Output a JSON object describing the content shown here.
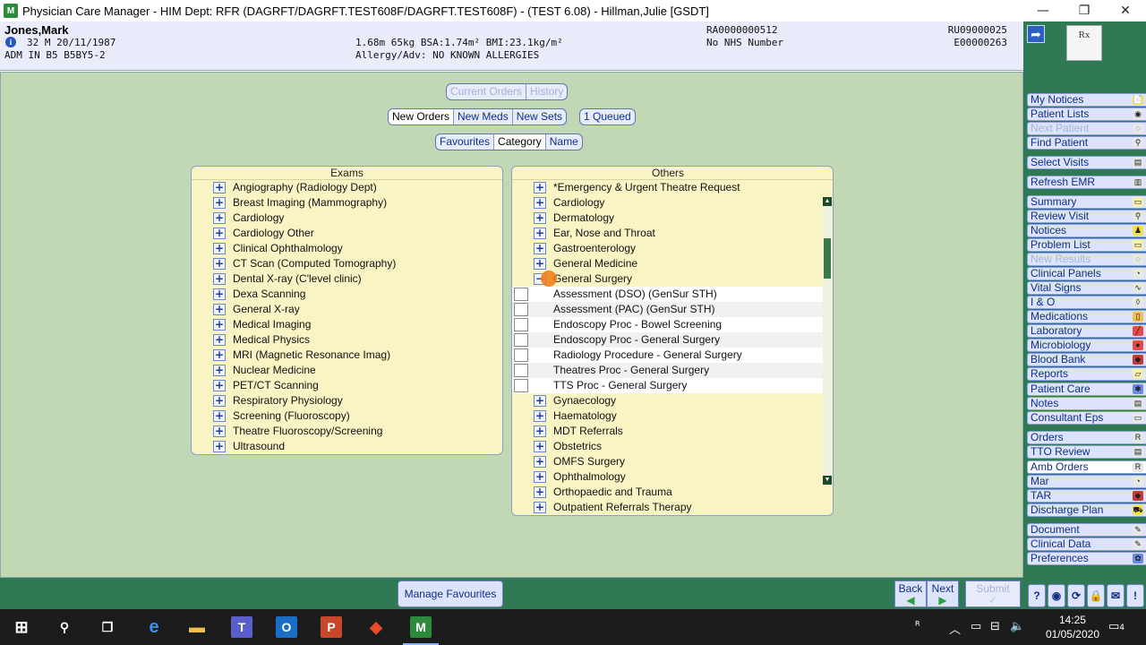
{
  "window": {
    "title": "Physician Care Manager - HIM Dept: RFR (DAGRFT/DAGRFT.TEST608F/DAGRFT.TEST608F) - (TEST 6.08) - Hillman,Julie [GSDT]",
    "app_icon": "M",
    "minimize_glyph": "—",
    "restore_glyph": "❐",
    "close_glyph": "✕"
  },
  "patient": {
    "name": "Jones,Mark",
    "info_glyph": "i",
    "demographics": "32  M  20/11/1987",
    "admission": "ADM IN  B5  B5BY5-2",
    "measurements": "1.68m  65kg  BSA:1.74m²  BMI:23.1kg/m²",
    "allergy": "Allergy/Adv: NO KNOWN ALLERGIES",
    "ra_number": "RA0000000512",
    "nhs": "No NHS Number",
    "ru_number": "RU09000025",
    "e_number": "E00000263"
  },
  "side_header": {
    "arrow_glyph": "➦",
    "rx_glyph": "Rx"
  },
  "sidebar": [
    {
      "label": "My Notices",
      "icon": "📄",
      "icon_color": "#f2e24a"
    },
    {
      "label": "Patient Lists",
      "icon": "◉",
      "icon_color": "#e8e8e8"
    },
    {
      "label": "Next Patient",
      "icon": "◌",
      "icon_color": "#e8e8e8",
      "disabled": true
    },
    {
      "label": "Find Patient",
      "icon": "⚲",
      "icon_color": "#e8e8e8"
    },
    {
      "label": "Select Visits",
      "icon": "▤",
      "icon_color": "#e8e8e8"
    },
    {
      "label": "Refresh EMR",
      "icon": "▥",
      "icon_color": "#e8e8e8"
    },
    {
      "label": "Summary",
      "icon": "▭",
      "icon_color": "#f6efb2"
    },
    {
      "label": "Review Visit",
      "icon": "⚲",
      "icon_color": "#e8e8e8"
    },
    {
      "label": "Notices",
      "icon": "♟",
      "icon_color": "#f2e24a"
    },
    {
      "label": "Problem List",
      "icon": "▭",
      "icon_color": "#f6efb2"
    },
    {
      "label": "New Results",
      "icon": "◌",
      "icon_color": "#e8e8e8",
      "disabled": true
    },
    {
      "label": "Clinical Panels",
      "icon": "◔",
      "icon_color": "#e8e8e8"
    },
    {
      "label": "Vital Signs",
      "icon": "∿",
      "icon_color": "#e8e8e8"
    },
    {
      "label": "I & O",
      "icon": "◊",
      "icon_color": "#e8e8e8"
    },
    {
      "label": "Medications",
      "icon": "▯",
      "icon_color": "#f2c04a"
    },
    {
      "label": "Laboratory",
      "icon": "╱",
      "icon_color": "#e84a4a"
    },
    {
      "label": "Microbiology",
      "icon": "●",
      "icon_color": "#e84a4a"
    },
    {
      "label": "Blood Bank",
      "icon": "◆",
      "icon_color": "#c83a3a"
    },
    {
      "label": "Reports",
      "icon": "▱",
      "icon_color": "#f6efb2"
    },
    {
      "label": "Patient Care",
      "icon": "✱",
      "icon_color": "#6a8ae8"
    },
    {
      "label": "Notes",
      "icon": "▤",
      "icon_color": "#e8e8e8"
    },
    {
      "label": "Consultant Eps",
      "icon": "▭",
      "icon_color": "#e8e8e8"
    },
    {
      "label": "Orders",
      "icon": "R",
      "icon_color": "#e8e8e8"
    },
    {
      "label": "TTO Review",
      "icon": "▤",
      "icon_color": "#e8e8e8"
    },
    {
      "label": "Amb Orders",
      "icon": "R",
      "icon_color": "#e8e8e8",
      "active": true
    },
    {
      "label": "Mar",
      "icon": "◔",
      "icon_color": "#e8e8e8"
    },
    {
      "label": "TAR",
      "icon": "◆",
      "icon_color": "#c83a3a"
    },
    {
      "label": "Discharge Plan",
      "icon": "⛟",
      "icon_color": "#f2e24a"
    },
    {
      "label": "Document",
      "icon": "✎",
      "icon_color": "#e8e8e8"
    },
    {
      "label": "Clinical Data",
      "icon": "✎",
      "icon_color": "#e8e8e8"
    },
    {
      "label": "Preferences",
      "icon": "✿",
      "icon_color": "#6a8ae8"
    }
  ],
  "toolbar": {
    "current_orders": "Current Orders",
    "history": "History",
    "new_orders": "New Orders",
    "new_meds": "New Meds",
    "new_sets": "New Sets",
    "queued": "1 Queued",
    "favourites": "Favourites",
    "category": "Category",
    "name": "Name"
  },
  "exams": {
    "header": "Exams",
    "plus_glyph": "+",
    "items": [
      "Angiography (Radiology Dept)",
      "Breast Imaging (Mammography)",
      "Cardiology",
      "Cardiology Other",
      "Clinical Ophthalmology",
      "CT Scan (Computed Tomography)",
      "Dental X-ray (C'level clinic)",
      "Dexa Scanning",
      "General X-ray",
      "Medical Imaging",
      "Medical Physics",
      "MRI (Magnetic Resonance Imag)",
      "Nuclear Medicine",
      "PET/CT Scanning",
      "Respiratory Physiology",
      "Screening (Fluoroscopy)",
      "Theatre Fluoroscopy/Screening",
      "Ultrasound"
    ]
  },
  "others": {
    "header": "Others",
    "plus_glyph": "+",
    "minus_glyph": "−",
    "items_before": [
      "*Emergency & Urgent Theatre Request",
      "Cardiology",
      "Dermatology",
      "Ear, Nose and Throat",
      "Gastroenterology",
      "General Medicine"
    ],
    "expanded": "General Surgery",
    "sub_items": [
      "Assessment (DSO) (GenSur STH)",
      "Assessment (PAC) (GenSur STH)",
      "Endoscopy Proc - Bowel Screening",
      "Endoscopy Proc - General Surgery",
      "Radiology Procedure - General Surgery",
      "Theatres Proc - General Surgery",
      "TTS Proc - General Surgery"
    ],
    "items_after": [
      "Gynaecology",
      "Haematology",
      "MDT Referrals",
      "Obstetrics",
      "OMFS Surgery",
      "Ophthalmology",
      "Orthopaedic and Trauma",
      "Outpatient Referrals Therapy"
    ],
    "scroll_fraction": 0.14
  },
  "bottom": {
    "manage_favourites": "Manage Favourites",
    "back": "Back",
    "next": "Next",
    "submit": "Submit",
    "back_glyph": "◀",
    "next_glyph": "▶",
    "submit_glyph": "✓",
    "help": "?",
    "tool2": "◉",
    "tool3": "⟳",
    "tool4": "🔒",
    "tool5": "✉",
    "alert": "!"
  },
  "taskbar": {
    "start_glyph": "⊞",
    "search_glyph": "⚲",
    "taskview_glyph": "❐",
    "edge_glyph": "e",
    "explorer_glyph": "▬",
    "teams_glyph": "T",
    "outlook_glyph": "O",
    "powerpoint_glyph": "P",
    "app7_glyph": "◆",
    "pcm_glyph": "M",
    "people_glyph": "ᴿ",
    "tray_up": "︿",
    "battery": "▭",
    "network": "⊟",
    "volume": "🔈",
    "time": "14:25",
    "date": "01/05/2020",
    "notifications": "4"
  }
}
